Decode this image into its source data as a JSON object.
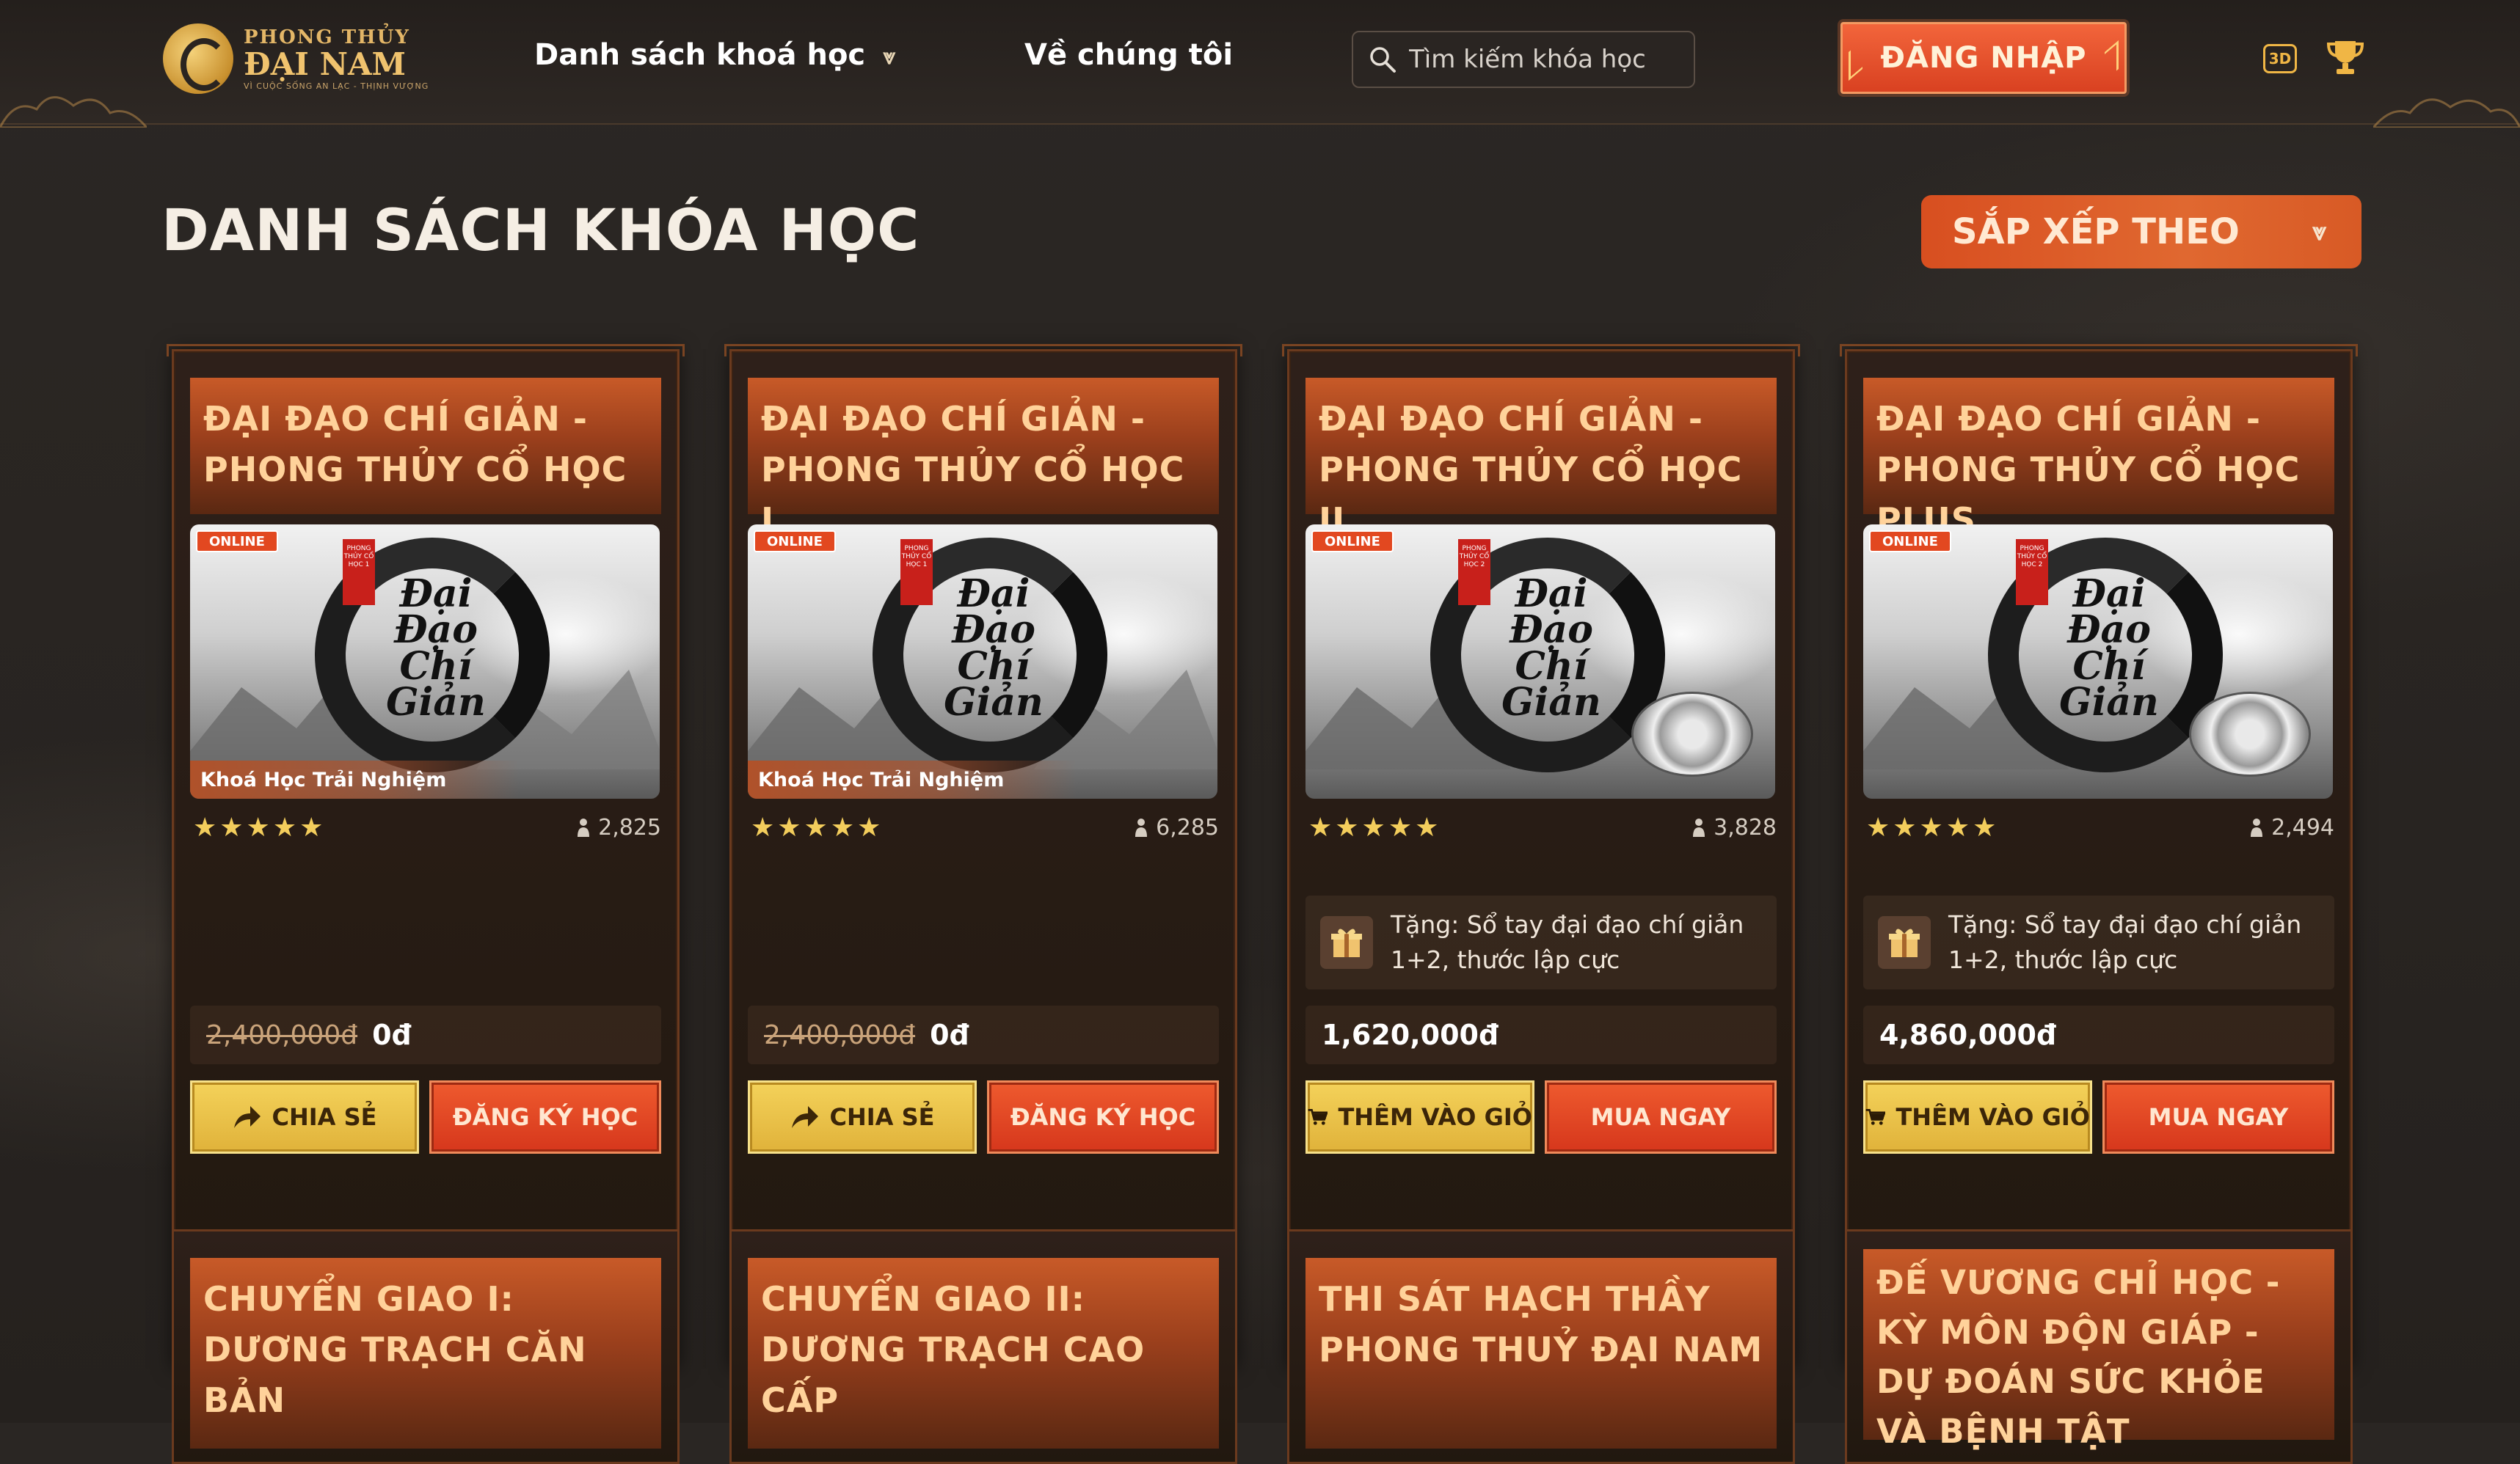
{
  "header": {
    "logo": {
      "line1": "PHONG THỦY",
      "line2": "ĐẠI NAM",
      "tagline": "VÌ CUỘC SỐNG AN LẠC - THỊNH VƯỢNG"
    },
    "nav": {
      "courses": "Danh sách khoá học",
      "about": "Về chúng tôi"
    },
    "search": {
      "placeholder": "Tìm kiếm khóa học"
    },
    "login": "ĐĂNG NHẬP",
    "icon_3d": "3D"
  },
  "page": {
    "title": "DANH SÁCH KHÓA HỌC",
    "sort_label": "SẮP XẾP THEO"
  },
  "courses": [
    {
      "title": "ĐẠI ĐẠO CHÍ GIẢN - PHONG THỦY CỔ HỌC",
      "badge": "ONLINE",
      "seal": "PHONG THỦY CỔ HỌC 1",
      "tag": "Khoá Học Trải Nghiệm",
      "stars": "★★★★★",
      "students": "2,825",
      "price_old": "2,400,000đ",
      "price": "0đ",
      "btn_left": "CHIA SẺ",
      "btn_right": "ĐĂNG KÝ HỌC"
    },
    {
      "title": "ĐẠI ĐẠO CHÍ GIẢN - PHONG THỦY CỔ HỌC I",
      "badge": "ONLINE",
      "seal": "PHONG THỦY CỔ HỌC 1",
      "tag": "Khoá Học Trải Nghiệm",
      "stars": "★★★★★",
      "students": "6,285",
      "price_old": "2,400,000đ",
      "price": "0đ",
      "btn_left": "CHIA SẺ",
      "btn_right": "ĐĂNG KÝ HỌC"
    },
    {
      "title": "ĐẠI ĐẠO CHÍ GIẢN - PHONG THỦY CỔ HỌC II",
      "badge": "ONLINE",
      "seal": "PHONG THỦY CỔ HỌC 2",
      "stars": "★★★★★",
      "students": "3,828",
      "gift": "Tặng: Sổ tay đại đạo chí giản 1+2, thước lập cực",
      "price": "1,620,000đ",
      "btn_left": "THÊM VÀO GIỎ",
      "btn_right": "MUA NGAY"
    },
    {
      "title": "ĐẠI ĐẠO CHÍ GIẢN - PHONG THỦY CỔ HỌC PLUS",
      "badge": "ONLINE",
      "seal": "PHONG THỦY CỔ HỌC 2",
      "stars": "★★★★★",
      "students": "2,494",
      "gift": "Tặng: Sổ tay đại đạo chí giản 1+2, thước lập cực",
      "price": "4,860,000đ",
      "btn_left": "THÊM VÀO GIỎ",
      "btn_right": "MUA NGAY"
    }
  ],
  "courses_row2": [
    {
      "title": "CHUYỂN GIAO I: DƯƠNG TRẠCH CĂN BẢN"
    },
    {
      "title": "CHUYỂN GIAO II: DƯƠNG TRẠCH CAO CẤP"
    },
    {
      "title": "THI SÁT HẠCH THẦY PHONG THUỶ ĐẠI NAM"
    },
    {
      "title": "ĐẾ VƯƠNG CHỈ HỌC - KỲ MÔN ĐỘN GIÁP - DỰ ĐOÁN SỨC KHỎE VÀ BỆNH TẬT"
    }
  ],
  "calligraphy": "Đại Đạo Chí Giản",
  "colors": {
    "accent": "#e24820",
    "gold": "#f3cd5c",
    "background": "#2a2623"
  }
}
